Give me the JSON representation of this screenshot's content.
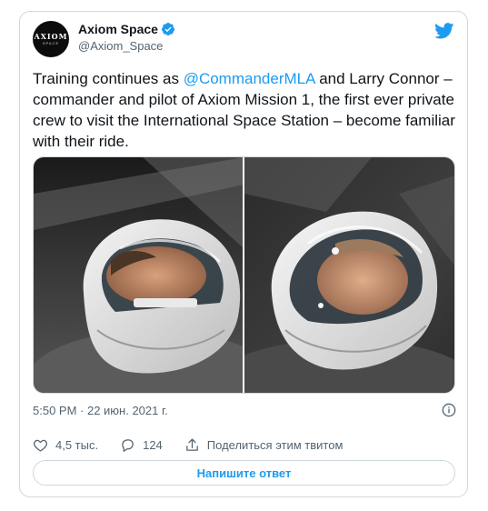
{
  "author": {
    "name": "Axiom Space",
    "handle": "@Axiom_Space",
    "avatar_word": "AXIOM",
    "avatar_sub": "SPACE"
  },
  "tweet": {
    "text_before": "Training continues as ",
    "mention": "@CommanderMLA",
    "text_after": " and Larry Connor – commander and pilot of Axiom Mission 1, the first ever private crew to visit the International Space Station – become familiar with their ride."
  },
  "timestamp": "5:50 PM · 22 июн. 2021 г.",
  "actions": {
    "likes": "4,5 тыс.",
    "replies": "124",
    "share": "Поделиться этим твитом"
  },
  "reply_button": "Напишите ответ",
  "icons": {
    "verified": "verified-badge-icon",
    "brand": "twitter-bird-icon",
    "info": "info-icon",
    "like": "heart-icon",
    "reply": "comment-icon",
    "share": "share-icon"
  },
  "colors": {
    "accent": "#1d9bf0",
    "text": "#0f1419",
    "muted": "#536471",
    "border": "#cfd9de"
  }
}
